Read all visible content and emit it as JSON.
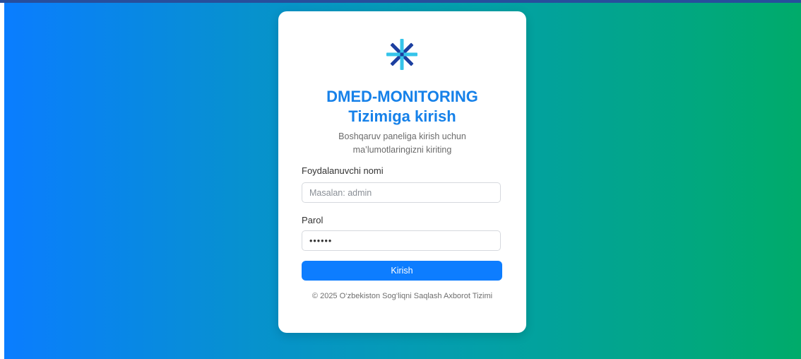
{
  "login": {
    "logo_icon": "asterisk-logo-icon",
    "title_line1": "DMED-MONITORING",
    "title_line2": "Tizimiga kirish",
    "subtitle_line1": "Boshqaruv paneliga kirish uchun",
    "subtitle_line2": "ma’lumotlaringizni kiriting",
    "username_label": "Foydalanuvchi nomi",
    "username_placeholder": "Masalan: admin",
    "username_value": "",
    "password_label": "Parol",
    "password_value": "••••••",
    "submit_label": "Kirish",
    "footer": "© 2025 O‘zbekiston Sog‘liqni Saqlash Axborot Tizimi"
  },
  "colors": {
    "accent": "#0d7dff",
    "title": "#1681e9",
    "gradient_start": "#0a7dff",
    "gradient_end": "#00ab6a",
    "logo_dark": "#1c3fa0",
    "logo_light": "#35c4ea"
  }
}
